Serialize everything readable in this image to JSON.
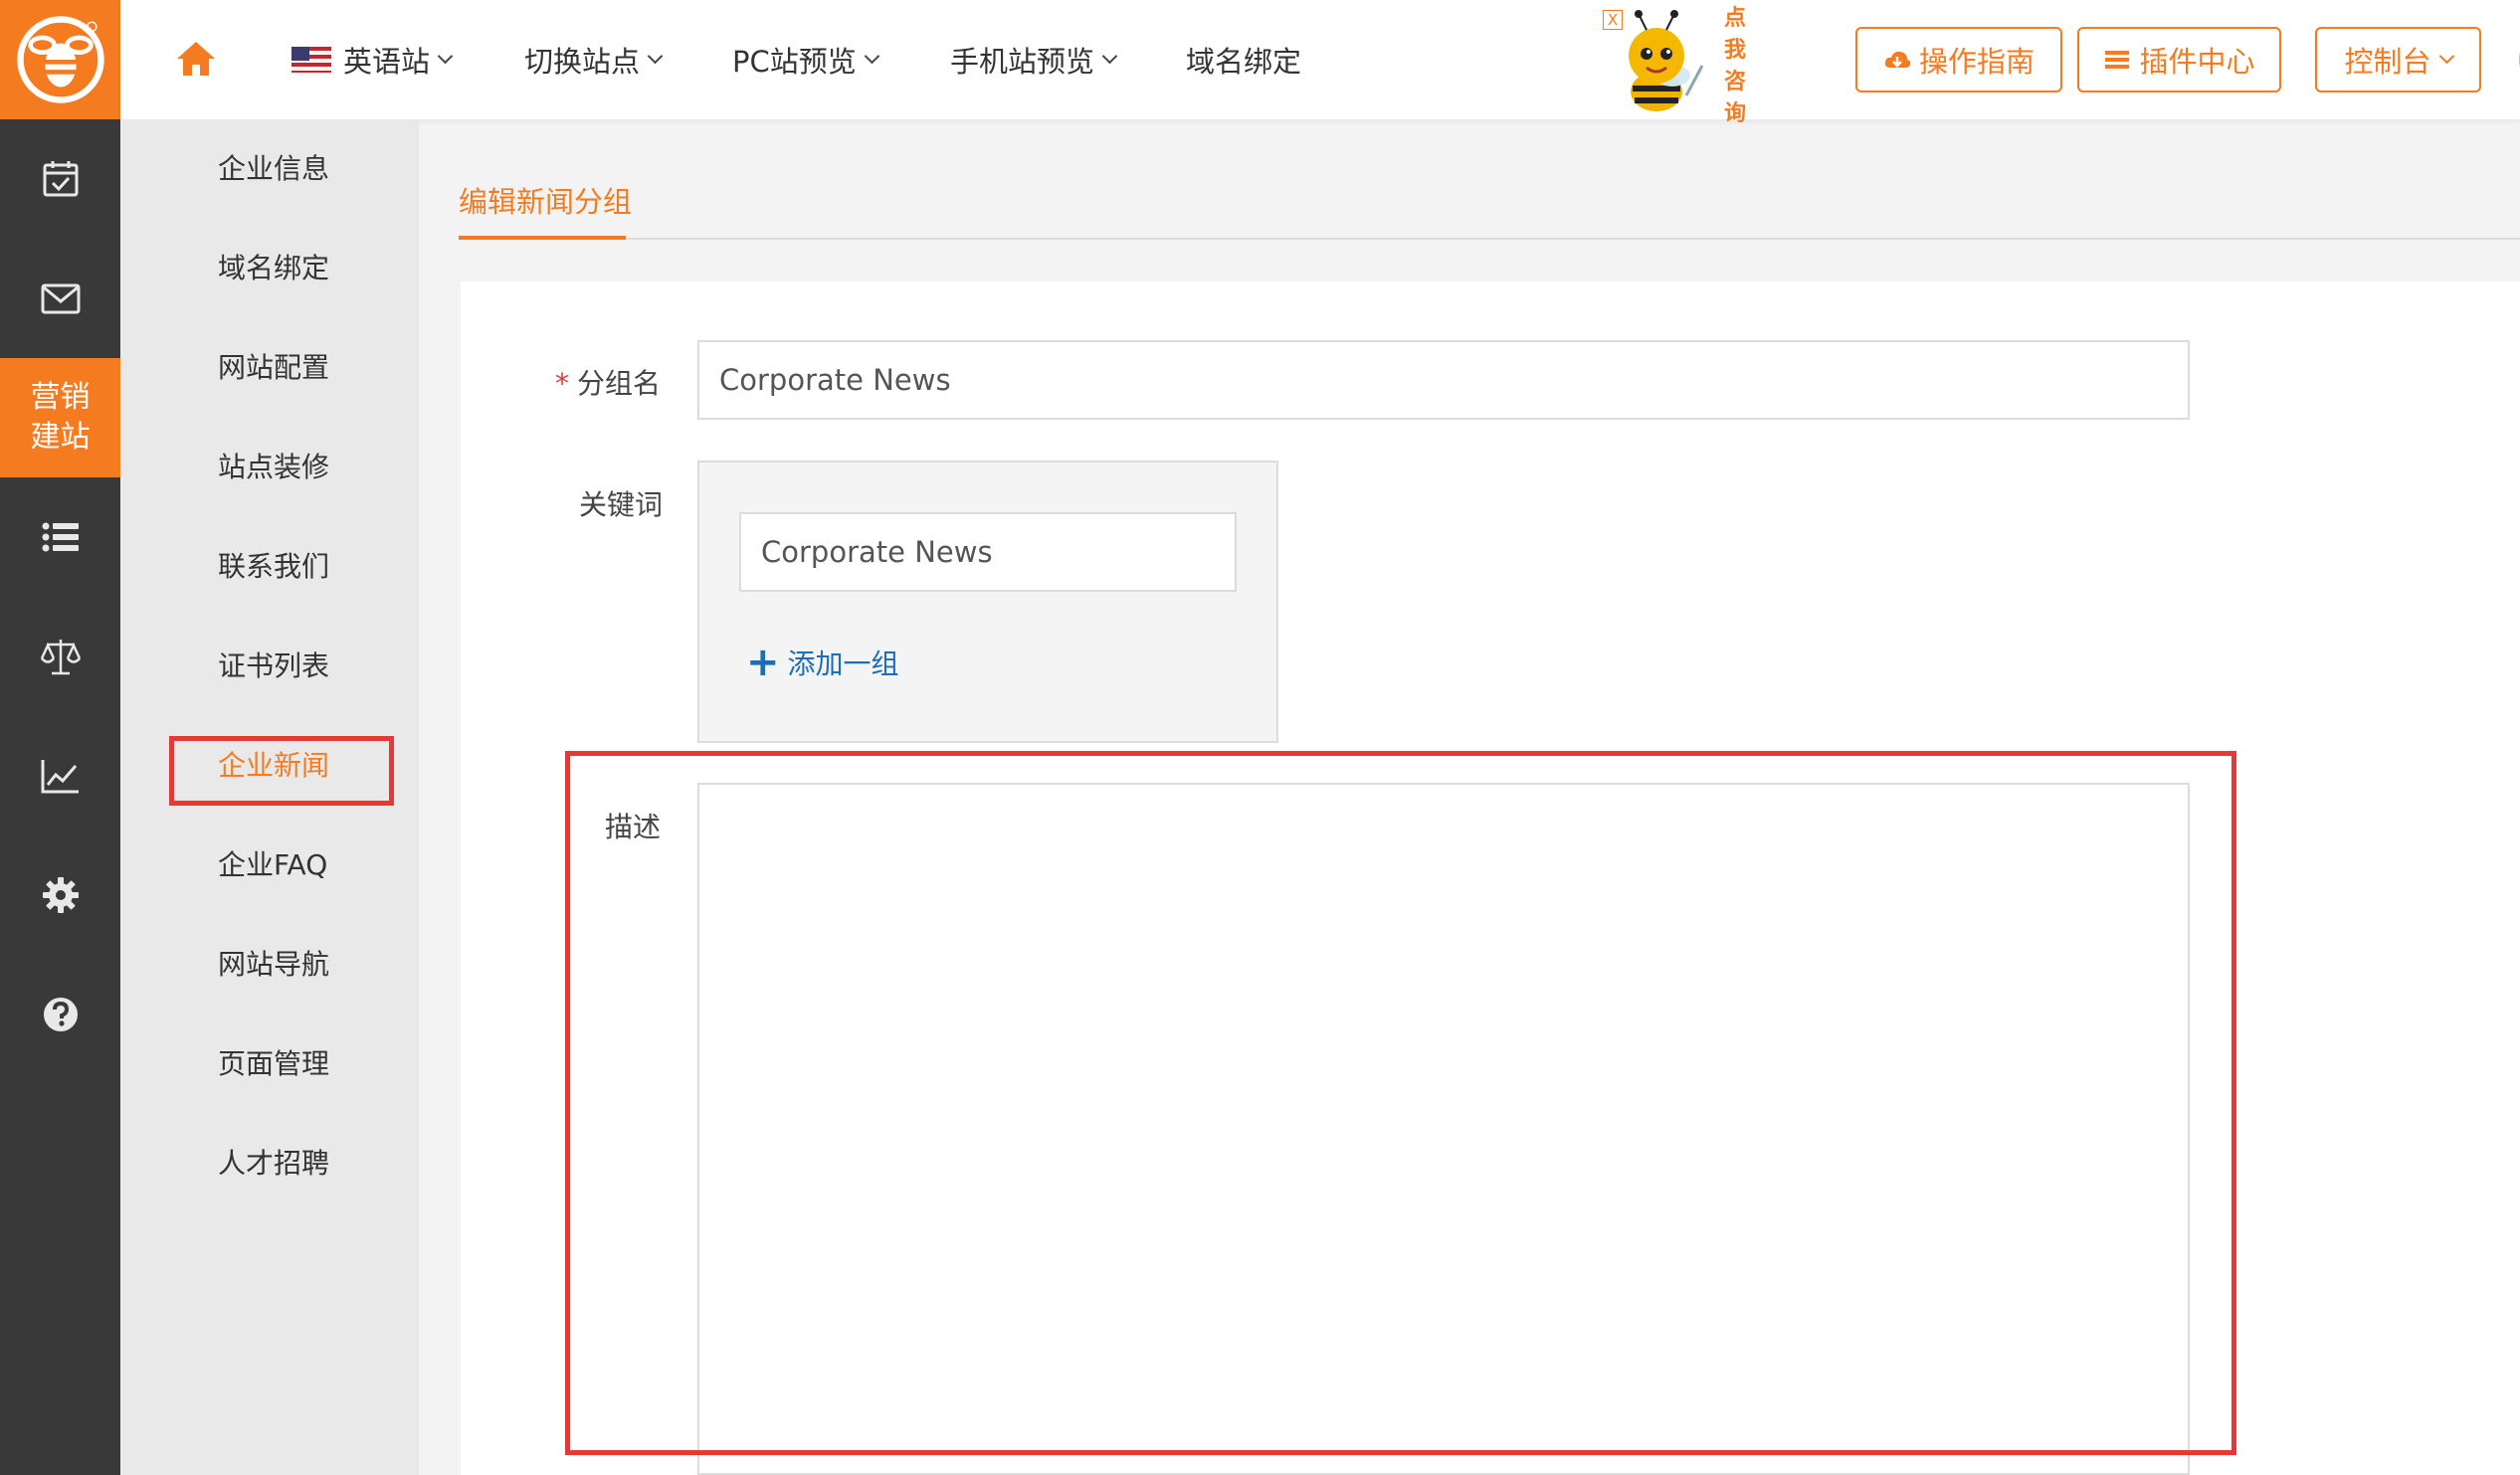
{
  "topbar": {
    "nav": [
      "英语站",
      "切换站点",
      "PC站预览",
      "手机站预览",
      "域名绑定"
    ],
    "mascot_text": "点我咨询",
    "mascot_close": "X",
    "buttons": {
      "guide": "操作指南",
      "plugins": "插件中心",
      "console": "控制台"
    }
  },
  "rail": {
    "active_label_1": "营销",
    "active_label_2": "建站",
    "icons": [
      "calendar-check-icon",
      "mail-icon",
      "list-icon",
      "balance-scale-icon",
      "line-chart-icon",
      "gear-icon",
      "help-icon"
    ]
  },
  "sidebar": {
    "items": [
      "企业信息",
      "域名绑定",
      "网站配置",
      "站点装修",
      "联系我们",
      "证书列表",
      "企业新闻",
      "企业FAQ",
      "网站导航",
      "页面管理",
      "人才招聘"
    ],
    "active_index": 6
  },
  "main": {
    "tab_title": "编辑新闻分组",
    "form": {
      "required_mark": "*",
      "group_name_label": "分组名",
      "group_name_value": "Corporate News",
      "keyword_label": "关键词",
      "keyword_value": "Corporate News",
      "add_group_label": "添加一组",
      "description_label": "描述",
      "description_value": ""
    }
  },
  "colors": {
    "accent": "#f47b20",
    "rail_bg": "#393939",
    "highlight": "#e53935",
    "link": "#1b6fb4"
  }
}
